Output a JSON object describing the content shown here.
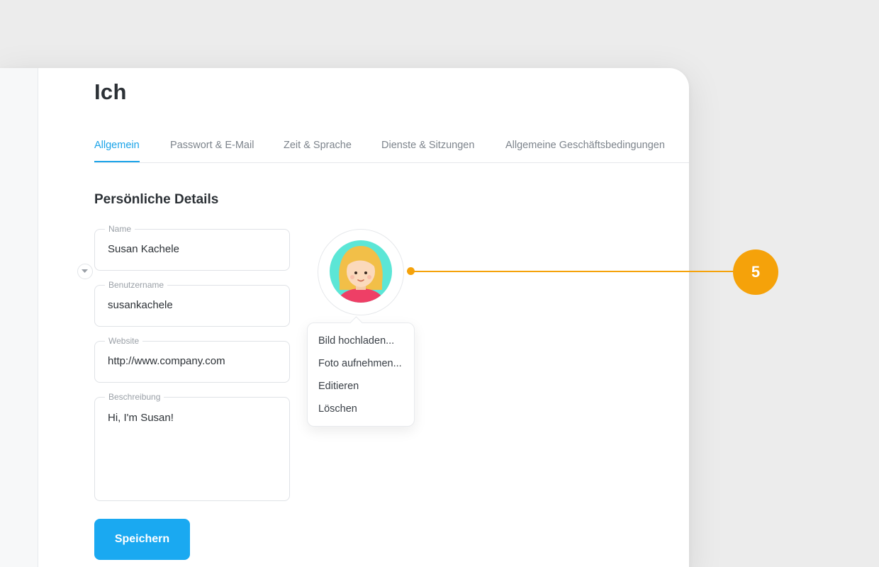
{
  "page": {
    "title": "Ich"
  },
  "tabs": [
    {
      "label": "Allgemein",
      "active": true
    },
    {
      "label": "Passwort & E-Mail",
      "active": false
    },
    {
      "label": "Zeit & Sprache",
      "active": false
    },
    {
      "label": "Dienste & Sitzungen",
      "active": false
    },
    {
      "label": "Allgemeine Geschäftsbedingungen",
      "active": false
    }
  ],
  "section": {
    "title": "Persönliche Details"
  },
  "fields": {
    "name": {
      "label": "Name",
      "value": "Susan Kachele"
    },
    "username": {
      "label": "Benutzername",
      "value": "susankachele"
    },
    "website": {
      "label": "Website",
      "value": "http://www.company.com"
    },
    "description": {
      "label": "Beschreibung",
      "value": "Hi, I'm Susan!"
    }
  },
  "actions": {
    "save_label": "Speichern"
  },
  "avatar_menu": {
    "items": [
      {
        "label": "Bild hochladen..."
      },
      {
        "label": "Foto aufnehmen..."
      },
      {
        "label": "Editieren"
      },
      {
        "label": "Löschen"
      }
    ]
  },
  "callout": {
    "number": "5"
  },
  "colors": {
    "accent": "#1aa3e8",
    "button": "#1aa9f1",
    "callout": "#f5a20a",
    "avatar_bg": "#5ce6d6",
    "avatar_shirt": "#ee3f66",
    "avatar_hair": "#f2bf48"
  },
  "icons": {
    "avatar_chevron": "chevron-down-icon",
    "avatar": "user-avatar-illustration"
  }
}
